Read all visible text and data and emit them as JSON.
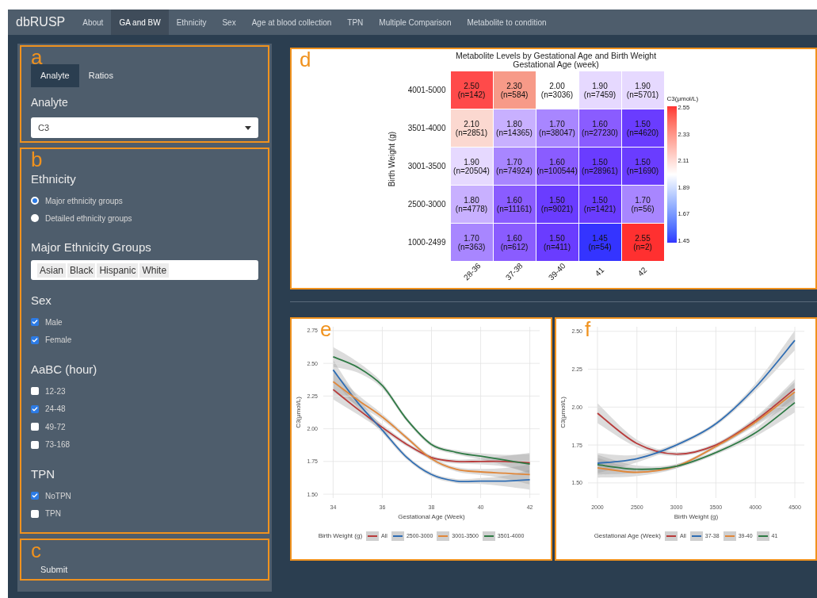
{
  "navbar": {
    "brand": "dbRUSP",
    "items": [
      {
        "label": "About",
        "selected": false
      },
      {
        "label": "GA and BW",
        "selected": true
      },
      {
        "label": "Ethnicity",
        "selected": false
      },
      {
        "label": "Sex",
        "selected": false
      },
      {
        "label": "Age at blood collection",
        "selected": false
      },
      {
        "label": "TPN",
        "selected": false
      },
      {
        "label": "Multiple Comparison",
        "selected": false
      },
      {
        "label": "Metabolite to condition",
        "selected": false
      }
    ]
  },
  "sidebar": {
    "panel_a": {
      "panel_label": "a",
      "tabs": [
        {
          "label": "Analyte",
          "selected": true
        },
        {
          "label": "Ratios",
          "selected": false
        }
      ],
      "select_label": "Analyte",
      "select_value": "C3"
    },
    "panel_b": {
      "panel_label": "b",
      "groups": [
        {
          "kind": "radio",
          "heading": "Ethnicity",
          "options": [
            {
              "label": "Major ethnicity groups",
              "selected": true
            },
            {
              "label": "Detailed ethnicity groups",
              "selected": false
            }
          ]
        },
        {
          "kind": "tags",
          "heading": "Major Ethnicity Groups",
          "tags": [
            "Asian",
            "Black",
            "Hispanic",
            "White"
          ]
        },
        {
          "kind": "checkbox",
          "heading": "Sex",
          "options": [
            {
              "label": "Male",
              "checked": true
            },
            {
              "label": "Female",
              "checked": true
            }
          ]
        },
        {
          "kind": "checkbox",
          "heading": "AaBC (hour)",
          "options": [
            {
              "label": "12-23",
              "checked": false
            },
            {
              "label": "24-48",
              "checked": true
            },
            {
              "label": "49-72",
              "checked": false
            },
            {
              "label": "73-168",
              "checked": false
            }
          ]
        },
        {
          "kind": "checkbox",
          "heading": "TPN",
          "options": [
            {
              "label": "NoTPN",
              "checked": true
            },
            {
              "label": "TPN",
              "checked": false
            }
          ]
        }
      ]
    },
    "panel_c": {
      "panel_label": "c",
      "button": "Submit"
    }
  },
  "heatmap_panel": {
    "panel_label": "d",
    "title": "Metabolite Levels by Gestational Age and Birth Weight",
    "subtitle": "Gestational Age (week)",
    "ylabel": "Birth Weight (g)",
    "rows": [
      {
        "label": "4001-5000",
        "cells": [
          {
            "value": "2.50",
            "n": "(n=142)",
            "color": "#ff4a4a"
          },
          {
            "value": "2.30",
            "n": "(n=584)",
            "color": "#f79a88"
          },
          {
            "value": "2.00",
            "n": "(n=3036)",
            "color": "#ffffff"
          },
          {
            "value": "1.90",
            "n": "(n=7459)",
            "color": "#e6d9ff"
          },
          {
            "value": "1.90",
            "n": "(n=5701)",
            "color": "#e6d9ff"
          }
        ]
      },
      {
        "label": "3501-4000",
        "cells": [
          {
            "value": "2.10",
            "n": "(n=2851)",
            "color": "#fbd8d0"
          },
          {
            "value": "1.80",
            "n": "(n=14365)",
            "color": "#c8b0ff"
          },
          {
            "value": "1.70",
            "n": "(n=38047)",
            "color": "#a886ff"
          },
          {
            "value": "1.60",
            "n": "(n=27230)",
            "color": "#8a5cff"
          },
          {
            "value": "1.50",
            "n": "(n=4620)",
            "color": "#6a3cff"
          }
        ]
      },
      {
        "label": "3001-3500",
        "cells": [
          {
            "value": "1.90",
            "n": "(n=20504)",
            "color": "#e6d9ff"
          },
          {
            "value": "1.70",
            "n": "(n=74924)",
            "color": "#a886ff"
          },
          {
            "value": "1.60",
            "n": "(n=100544)",
            "color": "#8a5cff"
          },
          {
            "value": "1.50",
            "n": "(n=28961)",
            "color": "#6a3cff"
          },
          {
            "value": "1.50",
            "n": "(n=1690)",
            "color": "#6a3cff"
          }
        ]
      },
      {
        "label": "2500-3000",
        "cells": [
          {
            "value": "1.80",
            "n": "(n=4778)",
            "color": "#c8b0ff"
          },
          {
            "value": "1.60",
            "n": "(n=11161)",
            "color": "#8a5cff"
          },
          {
            "value": "1.50",
            "n": "(n=9021)",
            "color": "#6a3cff"
          },
          {
            "value": "1.50",
            "n": "(n=1421)",
            "color": "#6a3cff"
          },
          {
            "value": "1.70",
            "n": "(n=56)",
            "color": "#a886ff"
          }
        ]
      },
      {
        "label": "1000-2499",
        "cells": [
          {
            "value": "1.70",
            "n": "(n=363)",
            "color": "#a886ff"
          },
          {
            "value": "1.60",
            "n": "(n=612)",
            "color": "#8a5cff"
          },
          {
            "value": "1.50",
            "n": "(n=411)",
            "color": "#6a3cff"
          },
          {
            "value": "1.45",
            "n": "(n=54)",
            "color": "#3434ff"
          },
          {
            "value": "2.55",
            "n": "(n=2)",
            "color": "#ff3030"
          }
        ]
      }
    ],
    "x_axis_labels": [
      "28-36",
      "37-38",
      "39-40",
      "41",
      "42"
    ],
    "legend": {
      "title": "C3(μmol/L)",
      "ticks": [
        "2.55",
        "2.33",
        "2.11",
        "1.89",
        "1.67",
        "1.45"
      ]
    }
  },
  "charts": [
    {
      "panel_label": "e",
      "legend_title": "Birth Weight (g)",
      "chart_data": {
        "type": "line",
        "grid": true,
        "xlabel": "Gestational Age (Week)",
        "ylabel": "C3(μmol/L)",
        "x": [
          34,
          35,
          36,
          37,
          38,
          39,
          40,
          41,
          42
        ],
        "xlim": [
          33.6,
          42.4
        ],
        "ylim": [
          1.47,
          2.78
        ],
        "xticks": [
          34,
          36,
          38,
          40,
          42
        ],
        "yticks": [
          {
            "value": 1.5,
            "label": "1.50"
          },
          {
            "value": 1.75,
            "label": "1.75"
          },
          {
            "value": 2,
            "label": "2.00"
          },
          {
            "value": 2.25,
            "label": "2.25"
          },
          {
            "value": 2.5,
            "label": "2.50"
          },
          {
            "value": 2.75,
            "label": "2.75"
          }
        ],
        "series": [
          {
            "name": "All",
            "color": "#b83b3b",
            "values": [
              2.3,
              2.15,
              2.01,
              1.88,
              1.78,
              1.75,
              1.75,
              1.75,
              1.74
            ]
          },
          {
            "name": "2500-3000",
            "color": "#2f6db3",
            "values": [
              2.45,
              2.2,
              1.99,
              1.78,
              1.65,
              1.6,
              1.6,
              1.6,
              1.61
            ]
          },
          {
            "name": "3001-3500",
            "color": "#e0873a",
            "values": [
              2.36,
              2.22,
              2.09,
              1.93,
              1.77,
              1.69,
              1.67,
              1.66,
              1.65
            ]
          },
          {
            "name": "3501-4000",
            "color": "#2f7a45",
            "values": [
              2.55,
              2.47,
              2.33,
              2.07,
              1.88,
              1.82,
              1.79,
              1.76,
              1.73
            ]
          }
        ]
      }
    },
    {
      "panel_label": "f",
      "legend_title": "Gestational Age (Week)",
      "chart_data": {
        "type": "line",
        "grid": true,
        "xlabel": "Birth Weight (g)",
        "ylabel": "C3(μmol/L)",
        "x": [
          2000,
          2500,
          3000,
          3500,
          4000,
          4500
        ],
        "xlim": [
          1880,
          4620
        ],
        "ylim": [
          1.4,
          2.53
        ],
        "xticks": [
          2000,
          2500,
          3000,
          3500,
          4000,
          4500
        ],
        "yticks": [
          {
            "value": 1.5,
            "label": "1.50"
          },
          {
            "value": 1.75,
            "label": "1.75"
          },
          {
            "value": 2,
            "label": "2.00"
          },
          {
            "value": 2.25,
            "label": "2.25"
          },
          {
            "value": 2.5,
            "label": "2.50"
          }
        ],
        "series": [
          {
            "name": "All",
            "color": "#b83b3b",
            "values": [
              1.96,
              1.76,
              1.69,
              1.75,
              1.91,
              2.12
            ]
          },
          {
            "name": "37-38",
            "color": "#2f6db3",
            "values": [
              1.63,
              1.66,
              1.75,
              1.89,
              2.13,
              2.44
            ]
          },
          {
            "name": "39-40",
            "color": "#e0873a",
            "values": [
              1.6,
              1.57,
              1.61,
              1.74,
              1.9,
              2.1
            ]
          },
          {
            "name": "41",
            "color": "#2f7a45",
            "values": [
              1.62,
              1.59,
              1.61,
              1.7,
              1.83,
              2.03
            ]
          }
        ]
      }
    }
  ]
}
